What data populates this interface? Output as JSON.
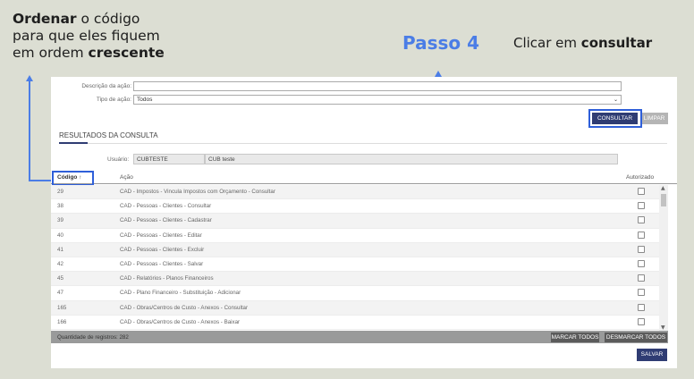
{
  "annotation": {
    "left_line1_bold": "Ordenar",
    "left_line1_rest": " o código",
    "left_line2": "para que eles fiquem",
    "left_line3_rest": "em ordem ",
    "left_line3_bold": "crescente",
    "step_title": "Passo 4",
    "step_text_rest": "Clicar em ",
    "step_text_bold": "consultar"
  },
  "form": {
    "descricao_label": "Descrição da ação:",
    "descricao_value": "",
    "tipo_label": "Tipo de ação:",
    "tipo_value": "Todos"
  },
  "buttons": {
    "consultar": "CONSULTAR",
    "limpar": "LIMPAR",
    "marcar_todos": "MARCAR TODOS",
    "desmarcar_todos": "DESMARCAR TODOS",
    "salvar": "SALVAR"
  },
  "results": {
    "title": "RESULTADOS DA CONSULTA",
    "usuario_label": "Usuário:",
    "usuario_code": "CUBTESTE",
    "usuario_name": "CUB teste"
  },
  "table": {
    "columns": [
      "Código ↑",
      "Ação",
      "Autorizado"
    ],
    "rows": [
      {
        "codigo": "29",
        "acao": "CAD - Impostos - Vincula Impostos com Orçamento - Consultar"
      },
      {
        "codigo": "38",
        "acao": "CAD - Pessoas - Clientes - Consultar"
      },
      {
        "codigo": "39",
        "acao": "CAD - Pessoas - Clientes - Cadastrar"
      },
      {
        "codigo": "40",
        "acao": "CAD - Pessoas - Clientes - Editar"
      },
      {
        "codigo": "41",
        "acao": "CAD - Pessoas - Clientes - Excluir"
      },
      {
        "codigo": "42",
        "acao": "CAD - Pessoas - Clientes - Salvar"
      },
      {
        "codigo": "45",
        "acao": "CAD - Relatórios - Planos Financeiros"
      },
      {
        "codigo": "47",
        "acao": "CAD - Plano Financeiro - Substituição - Adicionar"
      },
      {
        "codigo": "165",
        "acao": "CAD - Obras/Centros de Custo - Anexos - Consultar"
      },
      {
        "codigo": "166",
        "acao": "CAD - Obras/Centros de Custo - Anexos - Baixar"
      }
    ],
    "footer_count": "Quantidade de registros: 282"
  },
  "colors": {
    "accent": "#4b7de6",
    "primary_button": "#2f3c73",
    "highlight_border": "#2f5fd9",
    "background": "#dcded3"
  }
}
